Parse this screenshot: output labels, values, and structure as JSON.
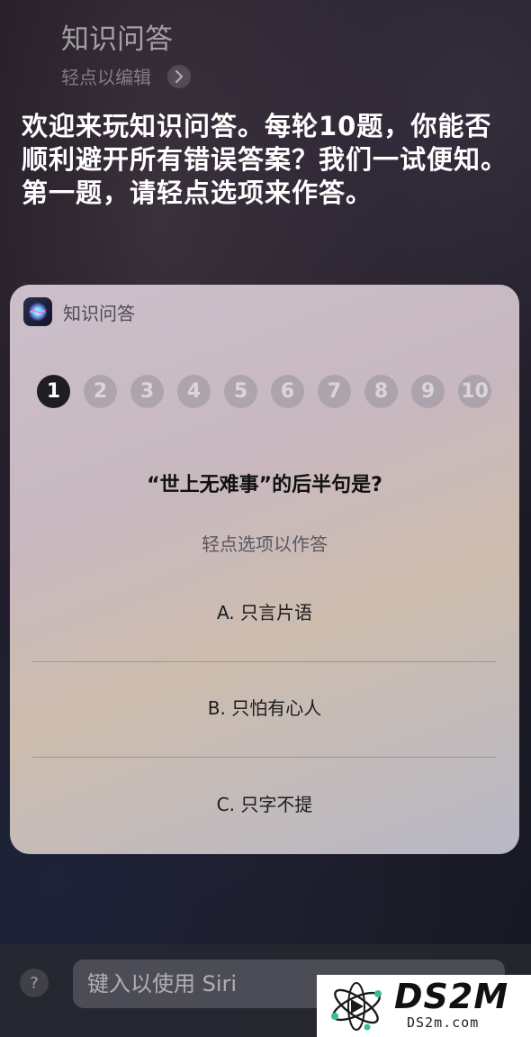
{
  "header": {
    "title": "知识问答",
    "edit_hint": "轻点以编辑"
  },
  "siri_response": "欢迎来玩知识问答。每轮10题，你能否顺利避开所有错误答案？我们一试便知。第一题，请轻点选项来作答。",
  "card": {
    "app_name": "知识问答",
    "progress": {
      "current": 1,
      "steps": [
        "1",
        "2",
        "3",
        "4",
        "5",
        "6",
        "7",
        "8",
        "9",
        "10"
      ]
    },
    "question": "“世上无难事”的后半句是?",
    "hint": "轻点选项以作答",
    "options": [
      {
        "label": "A. 只言片语"
      },
      {
        "label": "B. 只怕有心人"
      },
      {
        "label": "C. 只字不提"
      }
    ]
  },
  "bottom_bar": {
    "help_glyph": "?",
    "input_placeholder": "键入以使用 Siri"
  },
  "watermark": {
    "brand": "DS2M",
    "url": "DS2m.com"
  }
}
